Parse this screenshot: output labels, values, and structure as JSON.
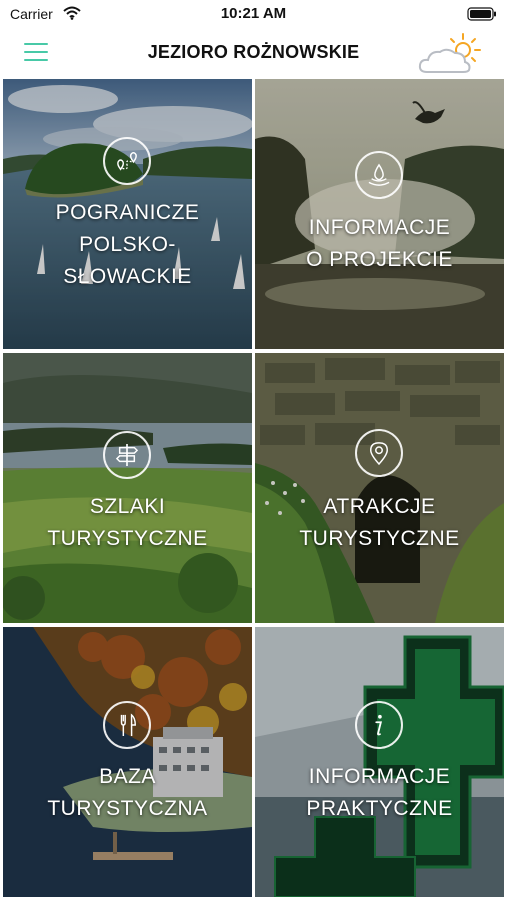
{
  "status_bar": {
    "carrier": "Carrier",
    "time": "10:21 AM",
    "wifi_icon": "wifi-icon",
    "battery_icon": "battery-icon"
  },
  "header": {
    "title": "JEZIORO ROŻNOWSKIE",
    "menu_icon": "hamburger-menu-icon",
    "weather_icon": "partly-cloudy-weather-icon"
  },
  "colors": {
    "accent": "#48c9a7",
    "weather_sun": "#f5a623",
    "weather_cloud": "#b9bdc4",
    "tile_text": "#ffffff"
  },
  "tiles": [
    {
      "lines": [
        "POGRANICZE",
        "POLSKO-",
        "SŁOWACKIE"
      ],
      "icon": "route-map-icon",
      "scene": "lake with island and sailboats"
    },
    {
      "lines": [
        "INFORMACJE",
        "O PROJEKCIE"
      ],
      "icon": "info-drop-icon",
      "scene": "misty lake with heron"
    },
    {
      "lines": [
        "SZLAKI",
        "TURYSTYCZNE"
      ],
      "icon": "signpost-icon",
      "scene": "green hills above lake"
    },
    {
      "lines": [
        "ATRAKCJE",
        "TURYSTYCZNE"
      ],
      "icon": "location-pin-icon",
      "scene": "stone wall with arch"
    },
    {
      "lines": [
        "BAZA",
        "TURYSTYCZNA"
      ],
      "icon": "fork-knife-icon",
      "scene": "hotel by the lake in autumn"
    },
    {
      "lines": [
        "INFORMACJE",
        "PRAKTYCZNE"
      ],
      "icon": "info-icon",
      "scene": "green pharmacy cross"
    }
  ]
}
